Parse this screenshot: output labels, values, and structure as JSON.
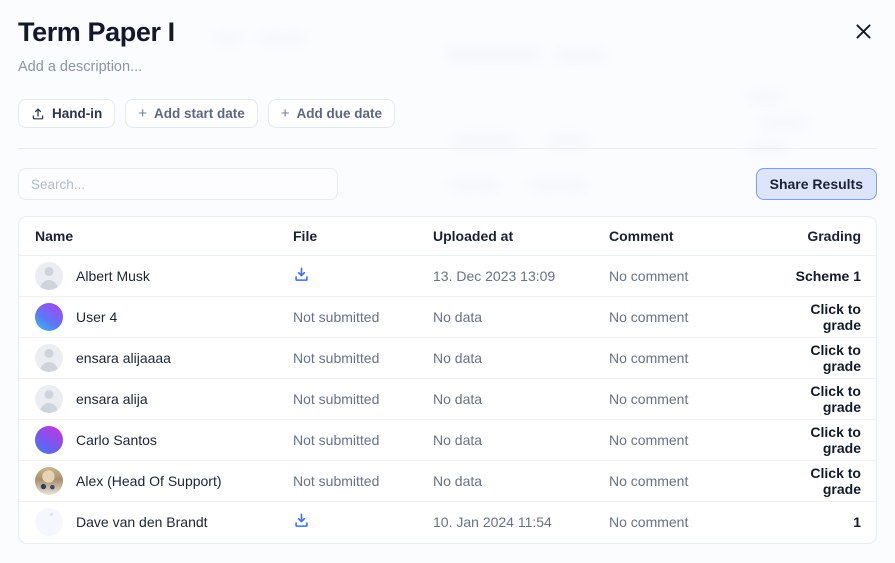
{
  "header": {
    "title": "Term Paper I",
    "description": "Add a description...",
    "close_icon": "close-icon"
  },
  "chips": [
    {
      "label": "Hand-in",
      "icon": "upload-icon",
      "has_plus": false
    },
    {
      "label": "Add start date",
      "icon": "plus-icon",
      "has_plus": true
    },
    {
      "label": "Add due date",
      "icon": "plus-icon",
      "has_plus": true
    }
  ],
  "toolbar": {
    "search_placeholder": "Search...",
    "search_value": "",
    "share_label": "Share Results"
  },
  "table": {
    "columns": [
      "Name",
      "File",
      "Uploaded at",
      "Comment",
      "Grading"
    ],
    "rows": [
      {
        "name": "Albert Musk",
        "avatar": "placeholder",
        "file": "download-icon",
        "file_kind": "icon",
        "uploaded_at": "13. Dec 2023 13:09",
        "comment": "No comment",
        "grading": "Scheme 1"
      },
      {
        "name": "User 4",
        "avatar": "gradient-cyan-magenta",
        "file": "Not submitted",
        "file_kind": "text",
        "uploaded_at": "No data",
        "comment": "No comment",
        "grading": "Click to grade"
      },
      {
        "name": "ensara alijaaaa",
        "avatar": "placeholder",
        "file": "Not submitted",
        "file_kind": "text",
        "uploaded_at": "No data",
        "comment": "No comment",
        "grading": "Click to grade"
      },
      {
        "name": "ensara alija",
        "avatar": "placeholder",
        "file": "Not submitted",
        "file_kind": "text",
        "uploaded_at": "No data",
        "comment": "No comment",
        "grading": "Click to grade"
      },
      {
        "name": "Carlo Santos",
        "avatar": "gradient-blue-magenta",
        "file": "Not submitted",
        "file_kind": "text",
        "uploaded_at": "No data",
        "comment": "No comment",
        "grading": "Click to grade"
      },
      {
        "name": "Alex (Head Of Support)",
        "avatar": "photo",
        "file": "Not submitted",
        "file_kind": "text",
        "uploaded_at": "No data",
        "comment": "No comment",
        "grading": "Click to grade"
      },
      {
        "name": "Dave van den Brandt",
        "avatar": "blank",
        "file": "download-icon",
        "file_kind": "icon",
        "uploaded_at": "10. Jan 2024 11:54",
        "comment": "No comment",
        "grading": "1"
      }
    ]
  },
  "colors": {
    "accent_blue": "#3b6ef6",
    "share_button_bg": "#dde5fc",
    "share_button_border": "#7d9bfb",
    "text_primary": "#1d2436",
    "text_muted": "#67718a",
    "page_bg": "#fbfcfe"
  }
}
